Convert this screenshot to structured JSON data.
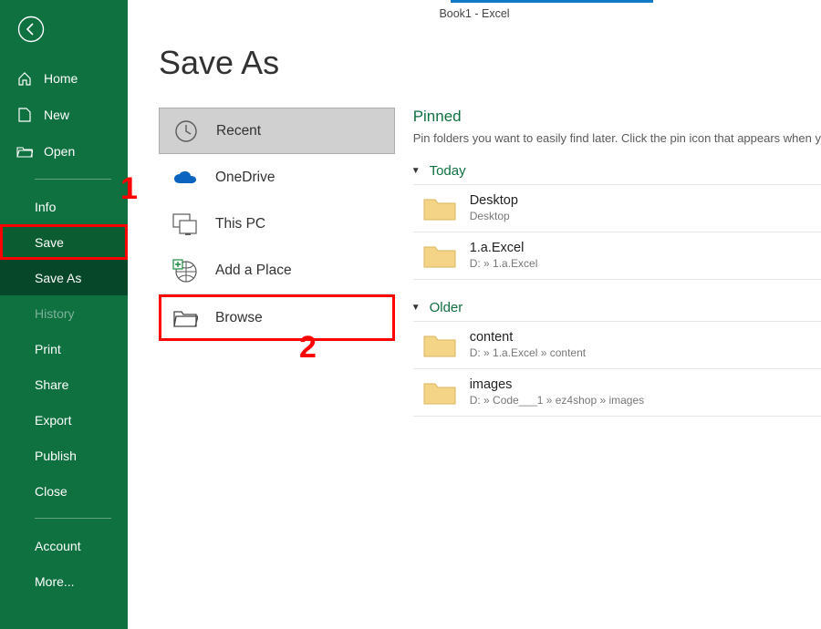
{
  "titlebar": "Book1  -  Excel",
  "page_title": "Save As",
  "sidebar": {
    "home": "Home",
    "new": "New",
    "open": "Open",
    "info": "Info",
    "save": "Save",
    "save_as": "Save As",
    "history": "History",
    "print": "Print",
    "share": "Share",
    "export": "Export",
    "publish": "Publish",
    "close": "Close",
    "account": "Account",
    "more": "More..."
  },
  "locations": {
    "recent": "Recent",
    "onedrive": "OneDrive",
    "this_pc": "This PC",
    "add_place": "Add a Place",
    "browse": "Browse"
  },
  "pinned": {
    "title": "Pinned",
    "desc": "Pin folders you want to easily find later. Click the pin icon that appears when y"
  },
  "groups": [
    {
      "label": "Today",
      "items": [
        {
          "name": "Desktop",
          "path": "Desktop"
        },
        {
          "name": "1.a.Excel",
          "path": "D: » 1.a.Excel"
        }
      ]
    },
    {
      "label": "Older",
      "items": [
        {
          "name": "content",
          "path": "D: » 1.a.Excel » content"
        },
        {
          "name": "images",
          "path": "D: » Code___1 » ez4shop » images"
        }
      ]
    }
  ],
  "annotations": {
    "one": "1",
    "two": "2"
  }
}
